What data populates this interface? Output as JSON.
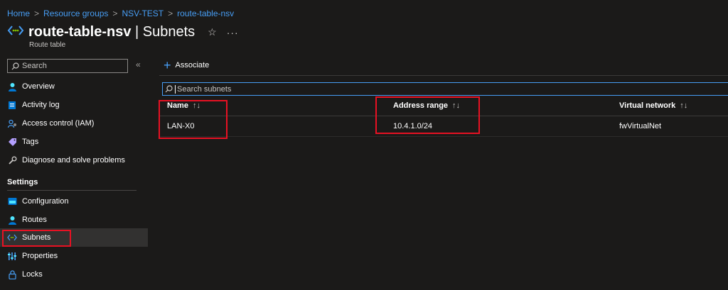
{
  "breadcrumb": [
    "Home",
    "Resource groups",
    "NSV-TEST",
    "route-table-nsv"
  ],
  "header": {
    "resource_name": "route-table-nsv",
    "separator": " | ",
    "page_name": "Subnets",
    "subtitle": "Route table",
    "star_icon": "star-icon",
    "more_icon": "more-icon"
  },
  "sidebar": {
    "search_placeholder": "Search",
    "collapse_glyph": "«",
    "items": [
      {
        "label": "Overview",
        "icon": "overview-icon"
      },
      {
        "label": "Activity log",
        "icon": "activity-log-icon"
      },
      {
        "label": "Access control (IAM)",
        "icon": "iam-icon"
      },
      {
        "label": "Tags",
        "icon": "tag-icon"
      },
      {
        "label": "Diagnose and solve problems",
        "icon": "wrench-icon"
      }
    ],
    "settings_label": "Settings",
    "settings_items": [
      {
        "label": "Configuration",
        "icon": "configuration-icon"
      },
      {
        "label": "Routes",
        "icon": "routes-icon"
      },
      {
        "label": "Subnets",
        "icon": "subnets-icon",
        "selected": true
      },
      {
        "label": "Properties",
        "icon": "properties-icon"
      },
      {
        "label": "Locks",
        "icon": "lock-icon"
      }
    ]
  },
  "toolbar": {
    "associate_label": "Associate"
  },
  "main": {
    "search_placeholder": "Search subnets",
    "sort_glyph": "↑↓",
    "columns": [
      "Name",
      "Address range",
      "Virtual network"
    ],
    "rows": [
      {
        "name": "LAN-X0",
        "address_range": "10.4.1.0/24",
        "virtual_network": "fwVirtualNet"
      }
    ]
  },
  "colors": {
    "background": "#1b1a19",
    "accent": "#479ef5",
    "highlight_box": "#e81123",
    "selected_nav": "#323130"
  }
}
